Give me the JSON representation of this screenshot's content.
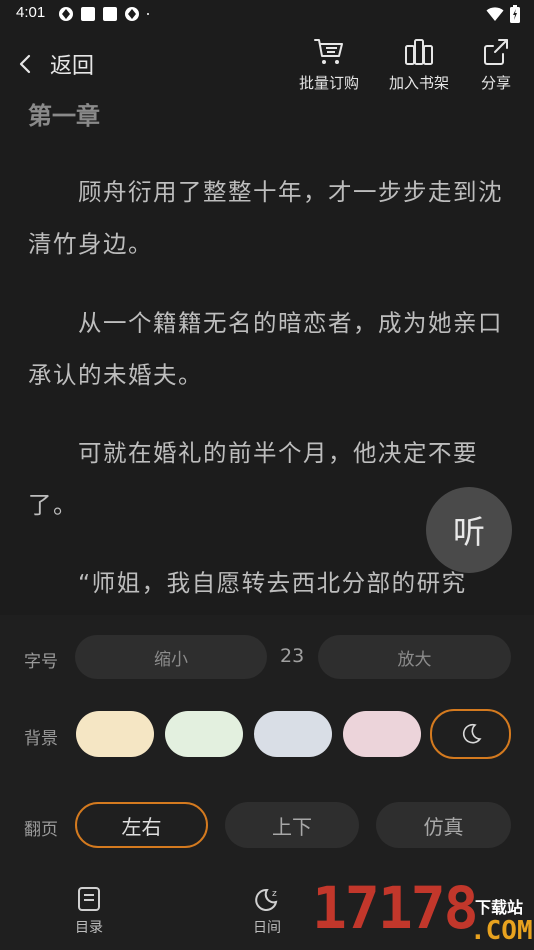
{
  "status_bar": {
    "time": "4:01"
  },
  "header": {
    "back_label": "返回",
    "tools": [
      {
        "label": "批量订购",
        "icon": "cart-icon"
      },
      {
        "label": "加入书架",
        "icon": "bookshelf-icon"
      },
      {
        "label": "分享",
        "icon": "share-icon"
      }
    ]
  },
  "content": {
    "chapter_title": "第一章",
    "paragraphs": [
      "顾舟衍用了整整十年，才一步步走到沈清竹身边。",
      "从一个籍籍无名的暗恋者，成为她亲口承认的未婚夫。",
      "可就在婚礼的前半个月，他决定不要了。",
      "“师姐，我自愿转去西北分部的研究"
    ],
    "listen_label": "听"
  },
  "settings": {
    "font_size": {
      "label": "字号",
      "decrease_label": "缩小",
      "value": "23",
      "increase_label": "放大"
    },
    "background": {
      "label": "背景",
      "swatches": [
        "#f5e6c4",
        "#e3f0df",
        "#d9dee6",
        "#ecd4da"
      ],
      "night_icon": "moon-icon",
      "selected": "night"
    },
    "page_turn": {
      "label": "翻页",
      "options": [
        "左右",
        "上下",
        "仿真"
      ],
      "selected": "左右"
    },
    "accent_color": "#d47a1f"
  },
  "bottom_nav": {
    "items": [
      {
        "label": "目录",
        "icon": "catalog-icon"
      },
      {
        "label": "日间",
        "icon": "day-night-icon"
      }
    ]
  },
  "watermark": {
    "number": "17178",
    "text": "下载站",
    "domain": ".COM"
  }
}
